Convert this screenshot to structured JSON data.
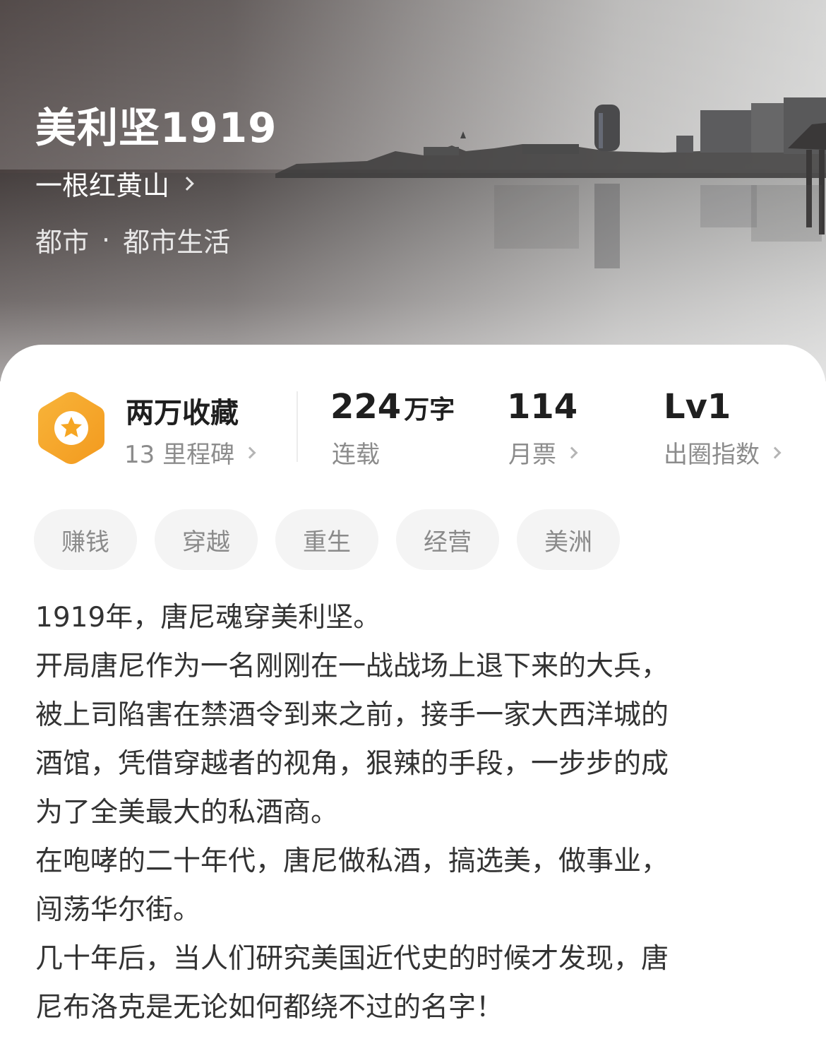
{
  "hero": {
    "title": "美利坚1919",
    "author": "一根红黄山",
    "genre_main": "都市",
    "genre_separator": "·",
    "genre_sub": "都市生活"
  },
  "stats": {
    "favorites_title": "两万收藏",
    "milestones_label": "13 里程碑",
    "word_count_value": "224",
    "word_count_unit": "万字",
    "status_label": "连载",
    "monthly_votes_value": "114",
    "monthly_votes_label": "月票",
    "influence_value": "Lv1",
    "influence_label": "出圈指数"
  },
  "tags": [
    "赚钱",
    "穿越",
    "重生",
    "经营",
    "美洲"
  ],
  "description": [
    "1919年，唐尼魂穿美利坚。",
    "开局唐尼作为一名刚刚在一战战场上退下来的大兵，",
    "被上司陷害在禁酒令到来之前，接手一家大西洋城的",
    "酒馆，凭借穿越者的视角，狠辣的手段，一步步的成",
    "为了全美最大的私酒商。",
    "在咆哮的二十年代，唐尼做私酒，搞选美，做事业，",
    "闯荡华尔街。",
    "几十年后，当人们研究美国近代史的时候才发现，唐",
    "尼布洛克是无论如何都绕不过的名字！"
  ],
  "colors": {
    "badge_orange": "#f6a623",
    "text_dark": "#1f1f1f",
    "text_gray": "#8c8c8c",
    "tag_bg": "#f4f4f4"
  },
  "icons": {
    "badge": "star-hexagon-icon",
    "chevron": "chevron-right-icon"
  }
}
